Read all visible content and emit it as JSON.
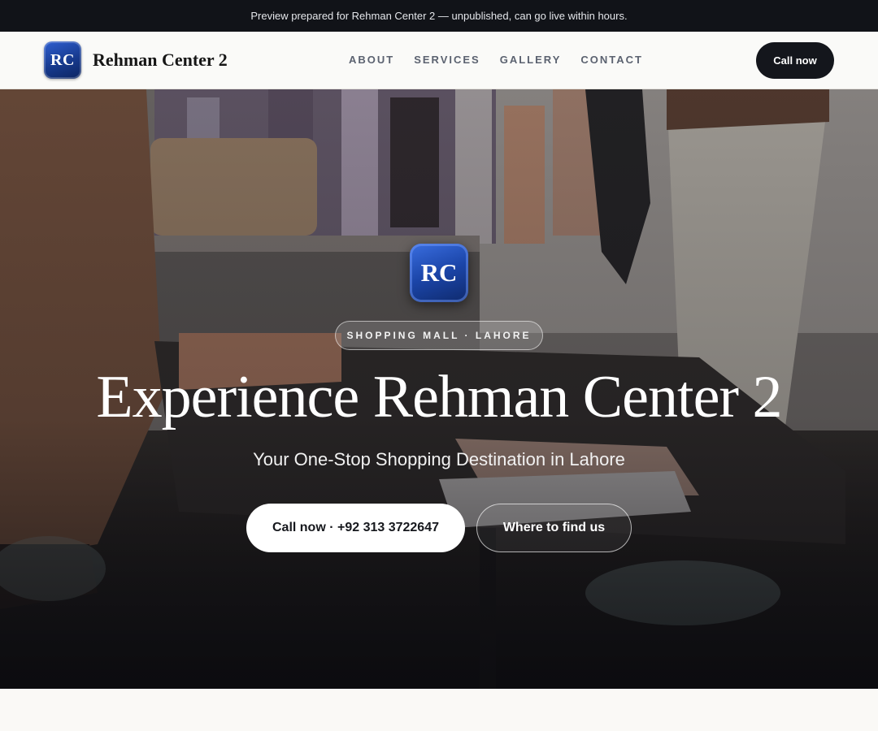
{
  "banner": {
    "text": "Preview prepared for Rehman Center 2 — unpublished, can go live within hours."
  },
  "header": {
    "logo_initials": "RC",
    "brand_name": "Rehman Center 2",
    "nav": [
      "ABOUT",
      "SERVICES",
      "GALLERY",
      "CONTACT"
    ],
    "call_label": "Call now"
  },
  "hero": {
    "logo_initials": "RC",
    "eyebrow": "SHOPPING MALL · LAHORE",
    "title": "Experience Rehman Center 2",
    "subtitle": "Your One-Stop Shopping Destination in Lahore",
    "primary_button": "Call now · +92 313 3722647",
    "secondary_button": "Where to find us"
  },
  "colors": {
    "banner_bg": "#111318",
    "header_bg": "#fafaf8",
    "logo_blue": "#1b45a8",
    "dark_button": "#14161c",
    "page_bg": "#faf9f6"
  }
}
